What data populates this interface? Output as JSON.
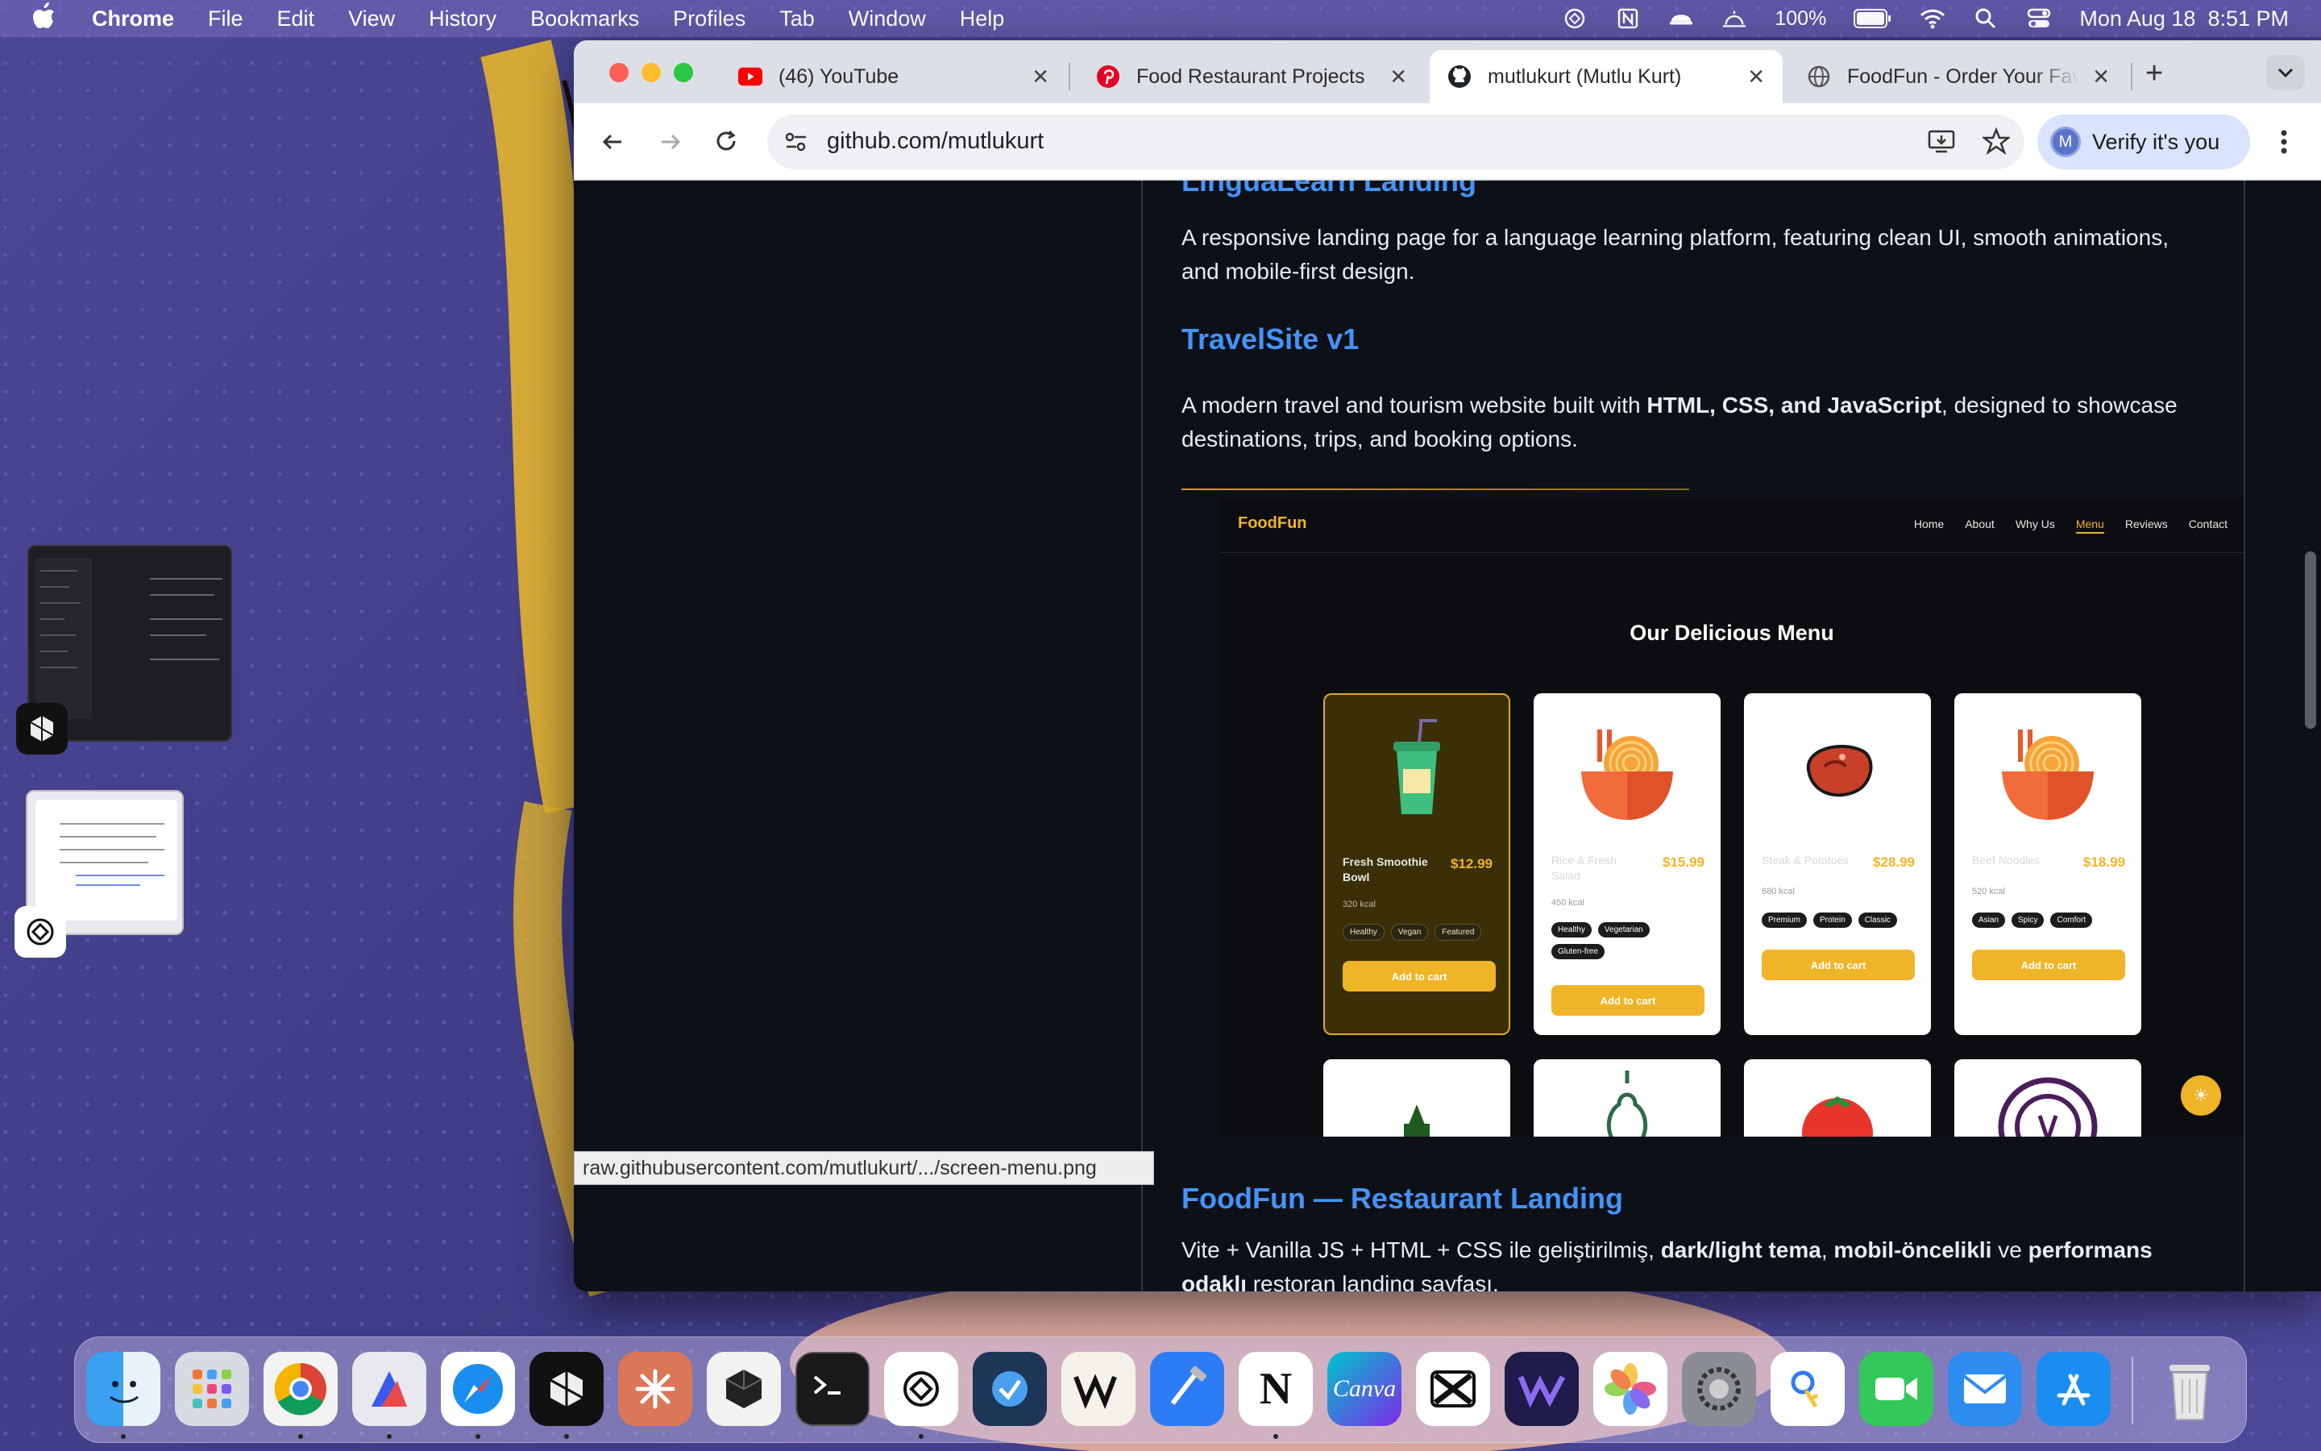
{
  "menubar": {
    "app": "Chrome",
    "items": [
      "File",
      "Edit",
      "View",
      "History",
      "Bookmarks",
      "Profiles",
      "Tab",
      "Window",
      "Help"
    ],
    "battery": "100%",
    "datetime": "Mon Aug 18  8:51 PM"
  },
  "tabs": [
    {
      "label": "(46) YouTube",
      "icon": "youtube-icon"
    },
    {
      "label": "Food Restaurant Projects",
      "icon": "pinterest-icon"
    },
    {
      "label": "mutlukurt (Mutlu Kurt)",
      "icon": "github-icon"
    },
    {
      "label": "FoodFun - Order Your Fav",
      "icon": "globe-icon"
    }
  ],
  "toolbar": {
    "url": "github.com/mutlukurt",
    "verify_label": "Verify it's you",
    "avatar_letter": "M"
  },
  "readme": {
    "lingua_title": "LinguaLearn Landing",
    "lingua_desc": "A responsive landing page for a language learning platform, featuring clean UI, smooth animations, and mobile-first design.",
    "travel_title": "TravelSite v1",
    "travel_desc_pre": "A modern travel and tourism website built with ",
    "travel_desc_bold": "HTML, CSS, and JavaScript",
    "travel_desc_post": ", designed to showcase destinations, trips, and booking options.",
    "foodfun_title": "FoodFun — Restaurant Landing",
    "foodfun_desc_1": "Vite + Vanilla JS + HTML + CSS ile geliştirilmiş, ",
    "foodfun_desc_b1": "dark/light tema",
    "foodfun_desc_2": ", ",
    "foodfun_desc_b2": "mobil-öncelikli",
    "foodfun_desc_3": " ve ",
    "foodfun_desc_b3": "performans odaklı",
    "foodfun_desc_4": " restoran landing sayfası."
  },
  "shot": {
    "brand": "FoodFun",
    "nav": [
      "Home",
      "About",
      "Why Us",
      "Menu",
      "Reviews",
      "Contact"
    ],
    "active_nav": "Menu",
    "title": "Our Delicious Menu",
    "cards": [
      {
        "name": "Fresh Smoothie Bowl",
        "price": "$12.99",
        "kcal": "320 kcal",
        "tags": [
          "Healthy",
          "Vegan",
          "Featured"
        ],
        "cart": "Add to cart"
      },
      {
        "name": "Rice & Fresh Salad",
        "price": "$15.99",
        "kcal": "450 kcal",
        "tags": [
          "Healthy",
          "Vegetarian",
          "Gluten-free"
        ],
        "cart": "Add to cart"
      },
      {
        "name": "Steak & Potatoes",
        "price": "$28.99",
        "kcal": "680 kcal",
        "tags": [
          "Premium",
          "Protein",
          "Classic"
        ],
        "cart": "Add to cart"
      },
      {
        "name": "Beef Noodles",
        "price": "$18.99",
        "kcal": "520 kcal",
        "tags": [
          "Asian",
          "Spicy",
          "Comfort"
        ],
        "cart": "Add to cart"
      }
    ]
  },
  "statusbar": "raw.githubusercontent.com/mutlukurt/.../screen-menu.png",
  "dock": [
    "Finder",
    "Launchpad",
    "Chrome",
    "Affinity",
    "Safari",
    "Perplexity",
    "Claude",
    "Cube",
    "Terminal",
    "ChatGPT",
    "Linear",
    "Warp",
    "Xcode",
    "Notion",
    "Canva",
    "CapCut",
    "Webflow",
    "Photos",
    "System Settings",
    "Passwords",
    "FaceTime",
    "Mail",
    "App Store",
    "Trash"
  ],
  "dock_labels": {
    "notion": "N",
    "canva": "Canva"
  },
  "colors": {
    "accent": "#4493f8",
    "gold": "#f0b429",
    "page_bg": "#0d1117"
  }
}
